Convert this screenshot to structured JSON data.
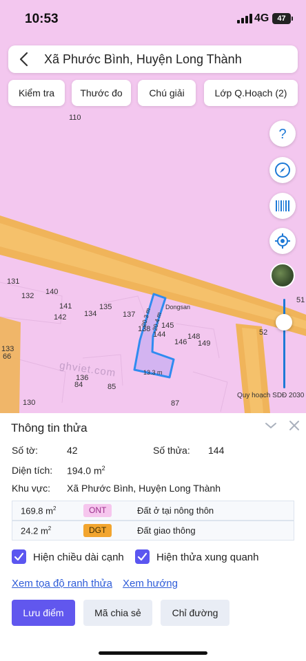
{
  "status_bar": {
    "time": "10:53",
    "network": "4G",
    "battery": "47"
  },
  "header": {
    "title": "Xã Phước Bình, Huyện Long Thành",
    "back_icon": "chevron-left-icon"
  },
  "toolbar": [
    {
      "label": "Kiểm tra"
    },
    {
      "label": "Thước đo"
    },
    {
      "label": "Chú giải"
    },
    {
      "label": "Lớp Q.Hoạch (2)"
    }
  ],
  "map": {
    "parcel_numbers": [
      "110",
      "131",
      "132",
      "140",
      "141",
      "142",
      "134",
      "135",
      "137",
      "138",
      "144",
      "145",
      "146",
      "148",
      "149",
      "133",
      "66",
      "136",
      "84",
      "85",
      "130",
      "87",
      "51",
      "52"
    ],
    "edge_lengths": [
      "20.3 m",
      "20.4 m",
      "13.3 m"
    ],
    "watermark": "ghviet.com",
    "pano_label": "Dongsan",
    "layer_caption": "Quy hoạch SDĐ 2030",
    "colors": {
      "residential": "#f3c7ef",
      "road": "#f0b45a",
      "parcel_outline": "#2f8bf0"
    },
    "right_controls": [
      "help-icon",
      "compass-icon",
      "barcode-icon",
      "locate-icon"
    ]
  },
  "sheet": {
    "title": "Thông tin thửa",
    "so_to_label": "Số tờ:",
    "so_to_value": "42",
    "so_thua_label": "Số thửa:",
    "so_thua_value": "144",
    "dien_tich_label": "Diện tích:",
    "dien_tich_value": "194.0",
    "dien_tich_unit": "m",
    "khu_vuc_label": "Khu vực:",
    "khu_vuc_value": "Xã Phước Bình, Huyện Long Thành",
    "land_uses": [
      {
        "area": "169.8",
        "unit": "m",
        "code": "ONT",
        "desc": "Đất ở tại nông thôn",
        "badge_color": "#f6c6ee",
        "text_color": "#9c2f8c"
      },
      {
        "area": "24.2",
        "unit": "m",
        "code": "DGT",
        "desc": "Đất giao thông",
        "badge_color": "#f2a52f",
        "text_color": "#3a2a00"
      }
    ],
    "check_edge_length": "Hiện chiều dài cạnh",
    "check_neighbors": "Hiện thửa xung quanh",
    "link_coords": "Xem tọa độ ranh thửa",
    "link_direction": "Xem hướng",
    "btn_save": "Lưu điểm",
    "btn_share": "Mã chia sẻ",
    "btn_directions": "Chỉ đường"
  }
}
